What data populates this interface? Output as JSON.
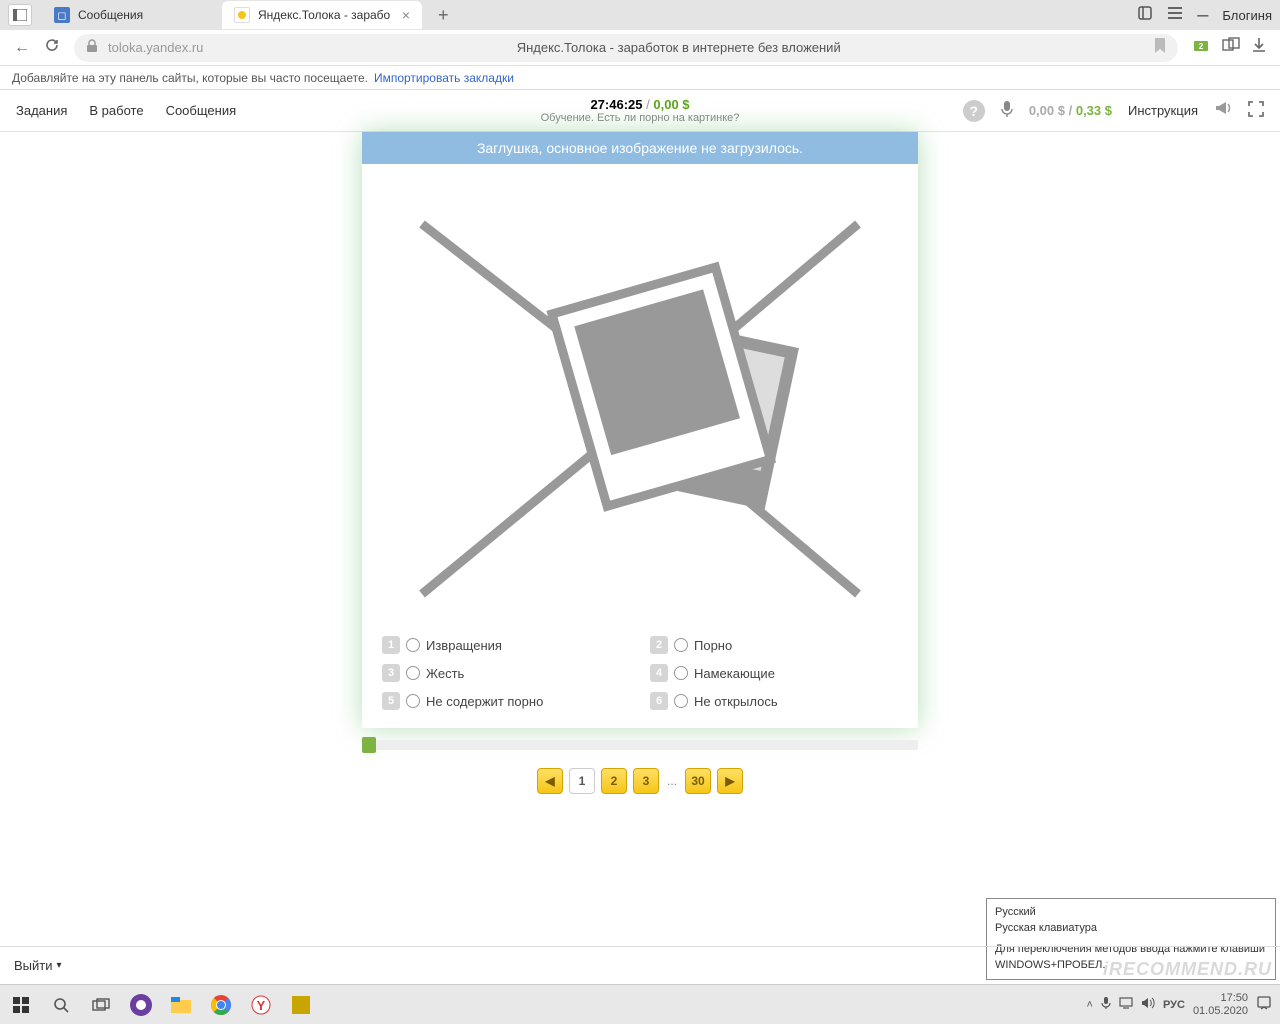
{
  "browser": {
    "tab1": "Сообщения",
    "tab2": "Яндекс.Толока - зарабо",
    "url": "toloka.yandex.ru",
    "page_title": "Яндекс.Толока - заработок в интернете без вложений",
    "profile": "Блогиня"
  },
  "bookmark": {
    "hint": "Добавляйте на эту панель сайты, которые вы часто посещаете.",
    "import": "Импортировать закладки"
  },
  "toloka": {
    "nav": {
      "tasks": "Задания",
      "work": "В работе",
      "msgs": "Сообщения"
    },
    "timer": "27:46:25",
    "sep": "/",
    "timer_money": "0,00 $",
    "task_name": "Обучение. Есть ли порно на картинке?",
    "earnings1": "0,00 $",
    "earnings_sep": "/",
    "earnings2": "0,33 $",
    "instr": "Инструкция"
  },
  "card": {
    "banner": "Заглушка, основное изображение не загрузилось.",
    "options": [
      {
        "key": "1",
        "label": "Извращения"
      },
      {
        "key": "2",
        "label": "Порно"
      },
      {
        "key": "3",
        "label": "Жесть"
      },
      {
        "key": "4",
        "label": "Намекающие"
      },
      {
        "key": "5",
        "label": "Не содержит порно"
      },
      {
        "key": "6",
        "label": "Не открылось"
      }
    ]
  },
  "pagination": {
    "p1": "1",
    "p2": "2",
    "p3": "3",
    "dots": "...",
    "last": "30",
    "prev": "◀",
    "next": "▶"
  },
  "footer": {
    "exit": "Выйти"
  },
  "ime": {
    "lang": "Русский",
    "kbd": "Русская клавиатура",
    "hint": "Для переключения методов ввода нажмите клавиши WINDOWS+ПРОБЕЛ."
  },
  "taskbar": {
    "lang": "РУС",
    "time": "17:50",
    "date": "01.05.2020"
  },
  "watermark": "iRECOMMEND.RU"
}
